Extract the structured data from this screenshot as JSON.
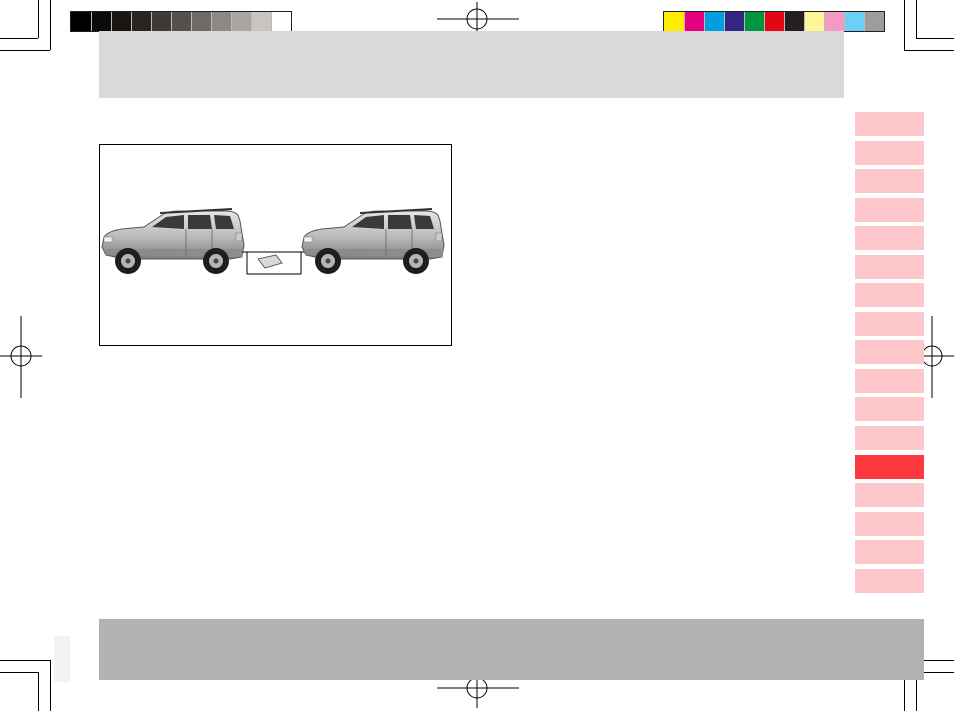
{
  "page": {
    "gray_swatches": [
      "#000000",
      "#0b0b0b",
      "#1c1410",
      "#2b2520",
      "#403a37",
      "#55504d",
      "#6f6a67",
      "#8d8885",
      "#a9a5a2",
      "#c8c4c1",
      "#ffffff"
    ],
    "color_swatches": [
      "#ffed00",
      "#e6007e",
      "#009fe3",
      "#312783",
      "#009640",
      "#e30613",
      "#231f20",
      "#fff59b",
      "#f39ac3",
      "#6ecff6",
      "#9d9d9c"
    ],
    "header_color": "#d9d9d9",
    "footer_color": "#b2b2b2"
  },
  "figure": {
    "icon": "towing-vehicles-illustration",
    "vehicle_count": 2
  },
  "chapter_tabs": {
    "count": 17,
    "active_index": 12,
    "inactive_color": "#fcc6ca",
    "active_color": "#fb393e"
  }
}
